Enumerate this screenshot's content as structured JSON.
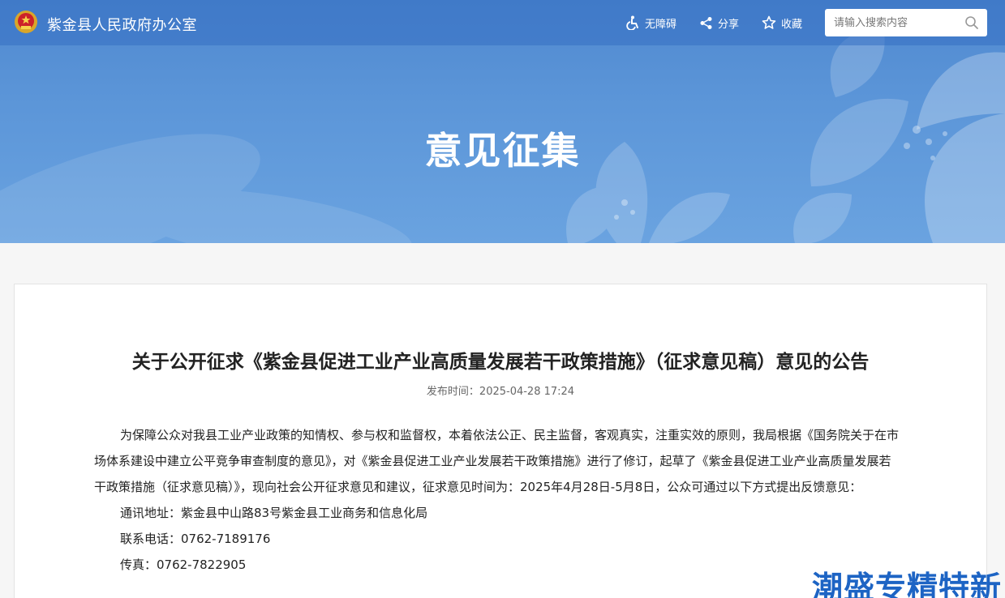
{
  "header": {
    "site_name": "紫金县人民政府办公室",
    "tools": {
      "accessibility": "无障碍",
      "share": "分享",
      "favorite": "收藏"
    },
    "search": {
      "placeholder": "请输入搜索内容"
    }
  },
  "banner": {
    "title": "意见征集"
  },
  "article": {
    "title": "关于公开征求《紫金县促进工业产业高质量发展若干政策措施》（征求意见稿）意见的公告",
    "publish_label": "发布时间：",
    "publish_time": "2025-04-28 17:24",
    "paragraph": "为保障公众对我县工业产业政策的知情权、参与权和监督权，本着依法公正、民主监督，客观真实，注重实效的原则，我局根据《国务院关于在市场体系建设中建立公平竞争审查制度的意见》，对《紫金县促进工业产业发展若干政策措施》进行了修订，起草了《紫金县促进工业产业高质量发展若干政策措施（征求意见稿）》，现向社会公开征求意见和建议，征求意见时间为：2025年4月28日-5月8日，公众可通过以下方式提出反馈意见：",
    "address": "通讯地址：紫金县中山路83号紫金县工业商务和信息化局",
    "phone": "联系电话：0762-7189176",
    "fax": "传真：0762-7822905"
  },
  "watermark": "潮盛专精特新",
  "colors": {
    "banner": "#5b95d8",
    "topbar": "#3470c3",
    "watermark": "#1d64c4"
  }
}
